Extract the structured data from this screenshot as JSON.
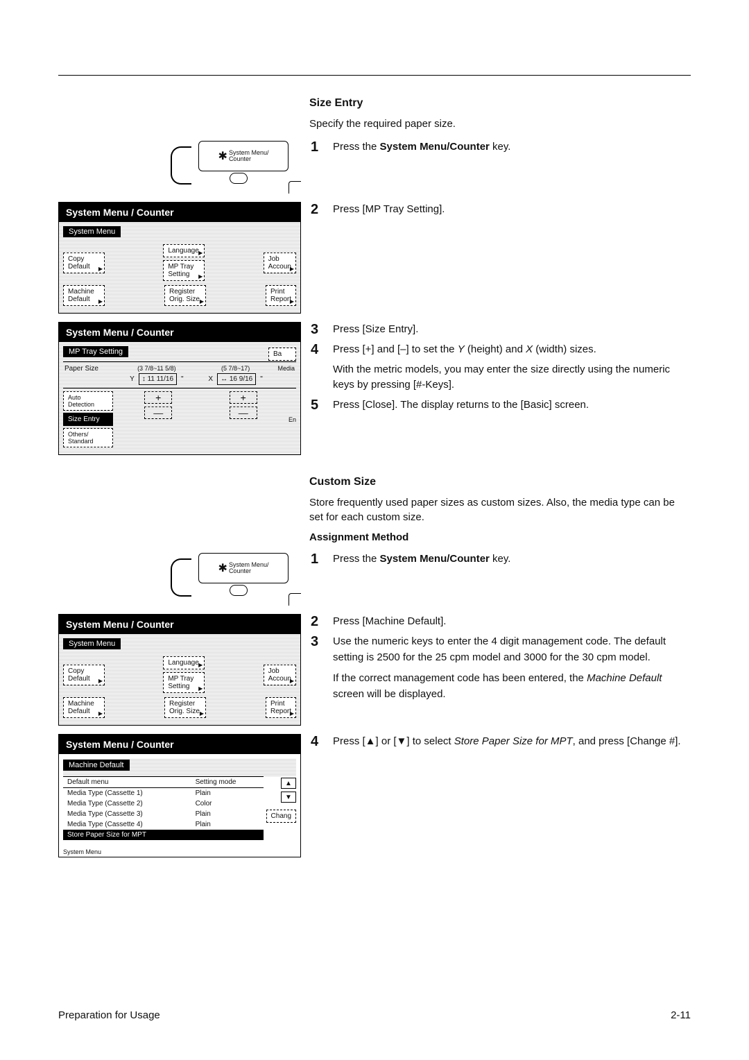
{
  "headings": {
    "size_entry": "Size Entry",
    "size_entry_intro": "Specify the required paper size.",
    "custom_size": "Custom Size",
    "custom_size_intro": "Store frequently used paper sizes as custom sizes. Also, the media type can be set for each custom size.",
    "assignment_method": "Assignment Method"
  },
  "steps_size_entry": {
    "s1": {
      "n": "1",
      "text_pre": "Press the ",
      "bold": "System Menu/Counter",
      "text_post": " key."
    },
    "s2": {
      "n": "2",
      "text": "Press [MP Tray Setting]."
    },
    "s3": {
      "n": "3",
      "text": "Press [Size Entry]."
    },
    "s4": {
      "n": "4",
      "line1_a": "Press [+] and [–] to set the ",
      "line1_y": "Y",
      "line1_b": " (height) and ",
      "line1_x": "X",
      "line1_c": " (width) sizes.",
      "line2": "With the metric models, you may enter the size directly using the numeric keys by pressing [#-Keys]."
    },
    "s5": {
      "n": "5",
      "text": "Press [Close]. The display returns to the [Basic] screen."
    }
  },
  "steps_custom": {
    "s1": {
      "n": "1",
      "text_pre": "Press the ",
      "bold": "System Menu/Counter",
      "text_post": " key."
    },
    "s2": {
      "n": "2",
      "text": "Press [Machine Default]."
    },
    "s3": {
      "n": "3",
      "line1": "Use the numeric keys to enter the 4 digit management code. The default setting is 2500 for the 25 cpm model and 3000 for the 30 cpm model.",
      "line2_a": "If the correct management code has been entered, the ",
      "line2_i": "Machine Default",
      "line2_b": " screen will be displayed."
    },
    "s4": {
      "n": "4",
      "a": "Press [▲] or [▼] to select ",
      "i": "Store Paper Size for MPT",
      "b": ", and press [Change #]."
    }
  },
  "key_button_label": "System Menu/\nCounter",
  "panel_title": "System Menu / Counter",
  "panel_a": {
    "subtitle": "System Menu",
    "left1": "Copy\nDefault",
    "left2": "Machine\nDefault",
    "mid1": "Language",
    "mid2": "MP Tray\nSetting",
    "mid3": "Register\nOrig. Size",
    "right1": "Job\nAccoun",
    "right2": "Print\nReport"
  },
  "panel_b": {
    "subtitle": "MP Tray Setting",
    "ba": "Ba",
    "paper_size": "Paper Size",
    "y_range": "(3 7/8~11 5/8)",
    "x_range": "(5 7/8~17)",
    "y_lbl": "Y",
    "x_lbl": "X",
    "y_val": "↕ 11 11/16",
    "x_val": "↔ 16 9/16",
    "inch": "\"",
    "media": "Media",
    "auto": "Auto\nDetection",
    "size_entry": "Size Entry",
    "standard": "Others/\nStandard",
    "en": "En",
    "plus": "+",
    "minus": "—"
  },
  "panel_c": {
    "subtitle": "Machine Default",
    "col_default": "Default menu",
    "col_setting": "Setting mode",
    "rows": [
      {
        "menu": "Media Type (Cassette 1)",
        "mode": "Plain"
      },
      {
        "menu": "Media Type (Cassette 2)",
        "mode": "Color"
      },
      {
        "menu": "Media Type (Cassette 3)",
        "mode": "Plain"
      },
      {
        "menu": "Media Type (Cassette 4)",
        "mode": "Plain"
      },
      {
        "menu": "Store Paper Size for MPT",
        "mode": ""
      }
    ],
    "up": "▲",
    "down": "▼",
    "change": "Chang",
    "footer": "System Menu"
  },
  "footer": {
    "left": "Preparation for Usage",
    "right": "2-11"
  }
}
